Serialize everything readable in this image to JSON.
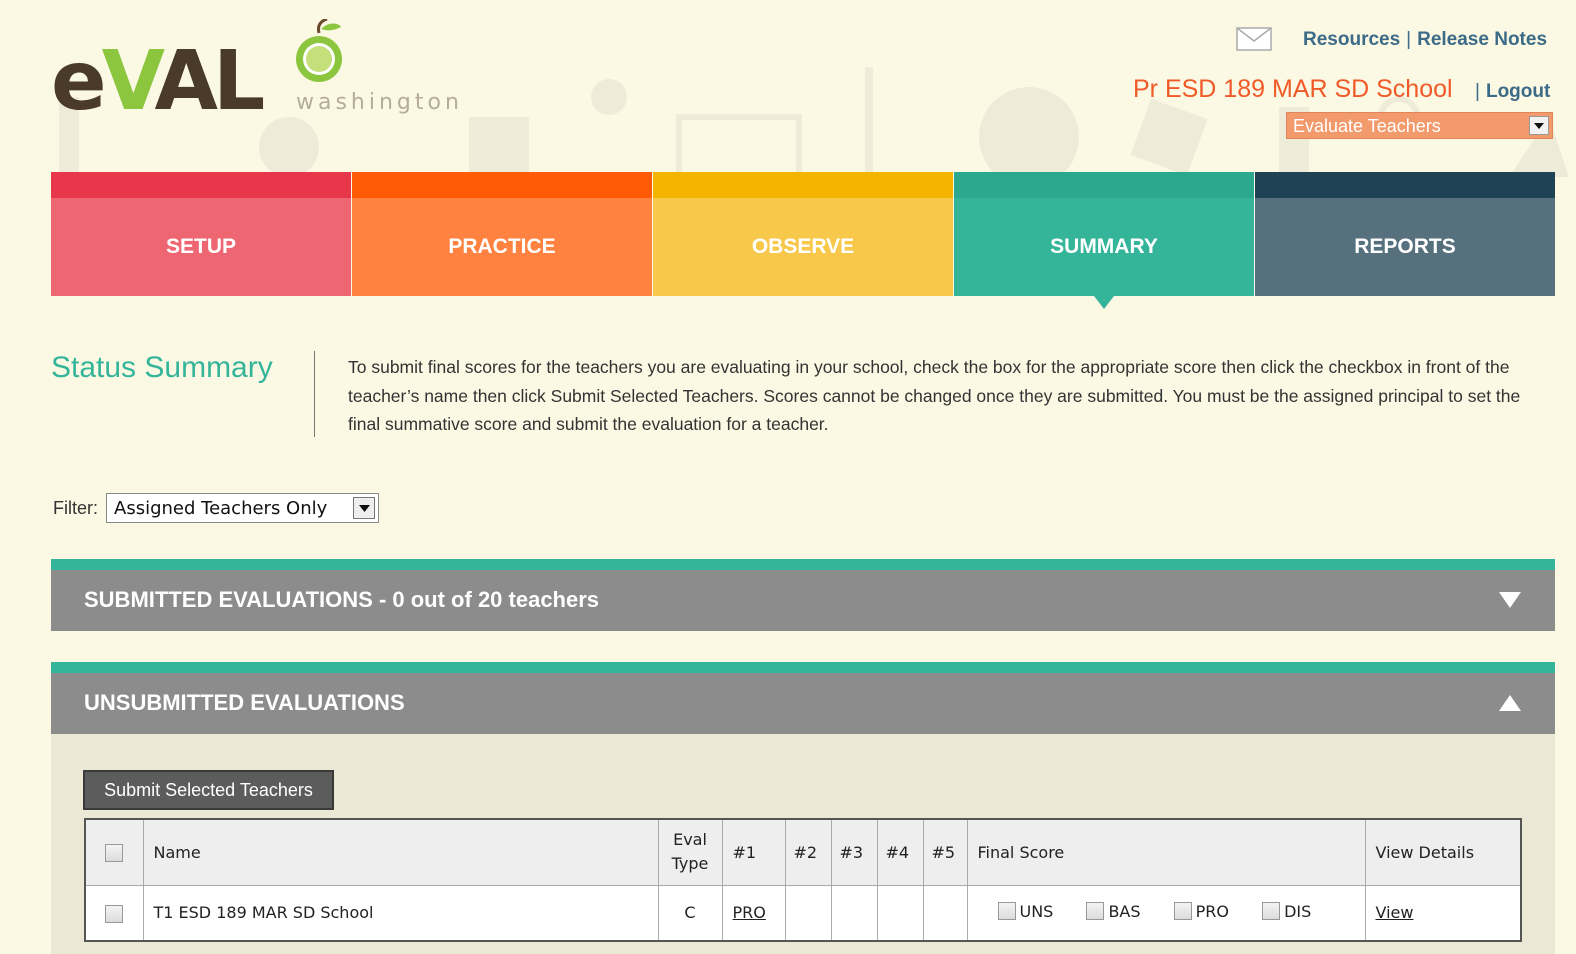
{
  "header": {
    "logo_main_e": "e",
    "logo_main_v": "V",
    "logo_main_al": "AL",
    "logo_sub": "washington",
    "links": [
      "Resources",
      "Release Notes"
    ],
    "link_separator": "|",
    "school_name": "Pr ESD 189 MAR SD School",
    "logout_sep": "|",
    "logout": "Logout",
    "role_select": "Evaluate Teachers",
    "icons": [
      "mail-icon",
      "apple-icon",
      "chevron-down-icon"
    ]
  },
  "tabs": [
    {
      "label": "SETUP",
      "bar_color": "#e8374a",
      "color": "#ef6673"
    },
    {
      "label": "PRACTICE",
      "bar_color": "#ff5a06",
      "color": "#ff8240"
    },
    {
      "label": "OBSERVE",
      "bar_color": "#f5b400",
      "color": "#f7c84a"
    },
    {
      "label": "SUMMARY",
      "bar_color": "#2ba88d",
      "color": "#34b59a",
      "active": true
    },
    {
      "label": "REPORTS",
      "bar_color": "#1d4355",
      "color": "#56707d"
    }
  ],
  "status": {
    "title": "Status Summary",
    "text": "To submit final scores for the teachers you are evaluating in your school, check the box for the appropriate score then click the checkbox in front of the teacher’s name then click Submit Selected Teachers. Scores cannot be changed once they are submitted. You must be the assigned principal to set the final summative score and submit the evaluation for a teacher."
  },
  "filter": {
    "label": "Filter:",
    "value": "Assigned Teachers Only"
  },
  "submitted": {
    "title": "SUBMITTED EVALUATIONS - 0 out of 20 teachers",
    "expanded": false
  },
  "unsubmitted": {
    "title": "UNSUBMITTED EVALUATIONS",
    "expanded": true,
    "submit_button": "Submit Selected Teachers",
    "columns": {
      "name": "Name",
      "eval_type_1": "Eval",
      "eval_type_2": "Type",
      "c1": "#1",
      "c2": "#2",
      "c3": "#3",
      "c4": "#4",
      "c5": "#5",
      "final_score": "Final Score",
      "view_details": "View Details"
    },
    "rows": [
      {
        "name": "T1 ESD 189 MAR SD School",
        "eval_type": "C",
        "c1": "PRO",
        "c2": "",
        "c3": "",
        "c4": "",
        "c5": "",
        "score_options": [
          "UNS",
          "BAS",
          "PRO",
          "DIS"
        ],
        "view": "View"
      }
    ]
  },
  "colors": {
    "accent_teal": "#34b59a",
    "school_orange": "#f05a28",
    "link_blue": "#3b6b86",
    "accordion_gray": "#8c8c8c",
    "background": "#fbf8e4"
  }
}
